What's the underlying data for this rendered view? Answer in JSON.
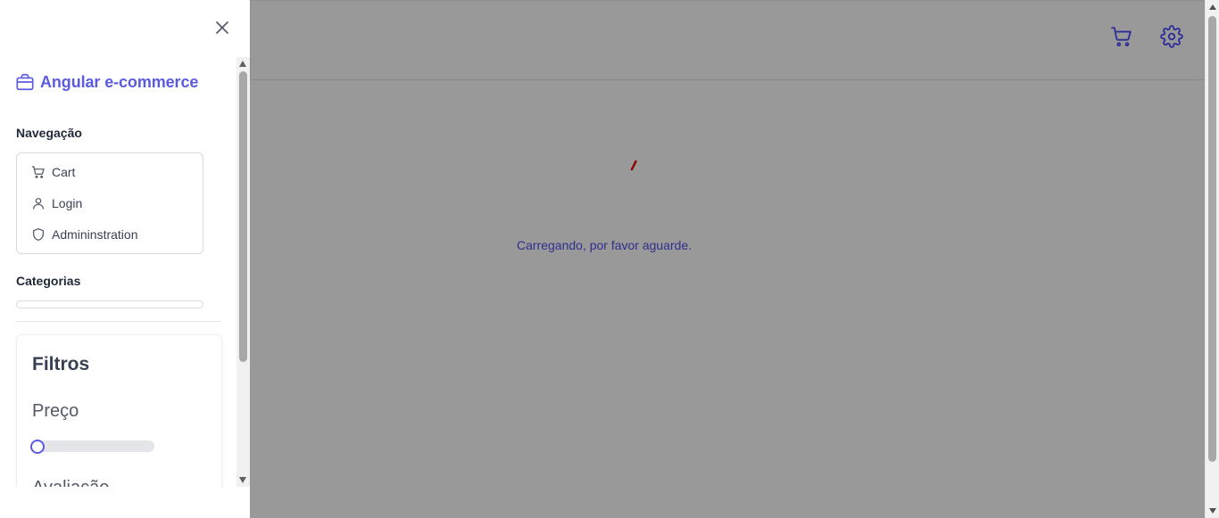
{
  "app": {
    "brand_name": "Angular e-commerce",
    "loading_text": "Carregando, por favor aguarde."
  },
  "header": {
    "icons": [
      "cart-icon",
      "gear-icon"
    ]
  },
  "sidebar": {
    "nav_title": "Navegação",
    "nav_items": [
      {
        "label": "Cart",
        "icon": "cart-icon"
      },
      {
        "label": "Login",
        "icon": "user-icon"
      },
      {
        "label": "Admininstration",
        "icon": "shield-icon"
      }
    ],
    "categories_title": "Categorias",
    "filters": {
      "title": "Filtros",
      "price_label": "Preço",
      "price_slider_value": 0,
      "rating_label": "Avaliação"
    }
  },
  "colors": {
    "accent": "#5b5be0",
    "overlay": "#999999",
    "loading_text": "#2f2f8f",
    "spinner": "#8b0000"
  }
}
